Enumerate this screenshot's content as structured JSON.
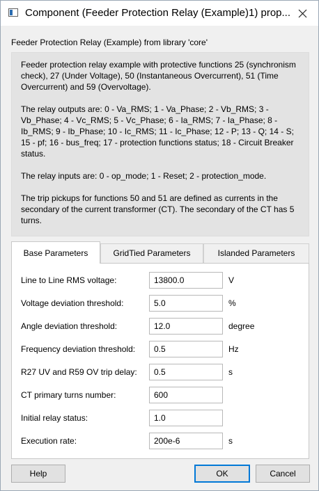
{
  "window": {
    "title": "Component (Feeder Protection Relay (Example)1) prop...",
    "close_glyph": "close-icon"
  },
  "heading": "Feeder Protection Relay (Example) from library 'core'",
  "description": [
    "Feeder protection relay example with protective functions 25 (synchronism check), 27 (Under Voltage), 50 (Instantaneous Overcurrent), 51 (Time Overcurrent) and 59 (Overvoltage).",
    "The relay outputs are: 0 - Va_RMS; 1 - Va_Phase; 2 - Vb_RMS; 3 - Vb_Phase; 4 - Vc_RMS; 5 - Vc_Phase; 6 - Ia_RMS; 7 - Ia_Phase; 8 - Ib_RMS; 9 - Ib_Phase; 10 - Ic_RMS; 11 - Ic_Phase; 12 - P; 13 - Q; 14 - S; 15 - pf; 16 - bus_freq; 17 - protection functions status; 18 - Circuit Breaker status.",
    "The relay inputs are: 0 - op_mode; 1 - Reset; 2 - protection_mode.",
    "The trip pickups for functions 50 and 51 are defined as currents in the secondary of the current transformer (CT). The secondary of the CT has 5 turns."
  ],
  "tabs": [
    "Base Parameters",
    "GridTied Parameters",
    "Islanded Parameters"
  ],
  "active_tab": "Base Parameters",
  "params": [
    {
      "label": "Line to Line RMS voltage:",
      "value": "13800.0",
      "unit": "V"
    },
    {
      "label": "Voltage deviation threshold:",
      "value": "5.0",
      "unit": "%"
    },
    {
      "label": "Angle deviation threshold:",
      "value": "12.0",
      "unit": "degree"
    },
    {
      "label": "Frequency deviation threshold:",
      "value": "0.5",
      "unit": "Hz"
    },
    {
      "label": "R27 UV and R59 OV trip delay:",
      "value": "0.5",
      "unit": "s"
    },
    {
      "label": "CT primary turns number:",
      "value": "600",
      "unit": ""
    },
    {
      "label": "Initial relay status:",
      "value": "1.0",
      "unit": ""
    },
    {
      "label": "Execution rate:",
      "value": "200e-6",
      "unit": "s"
    }
  ],
  "buttons": {
    "help": "Help",
    "ok": "OK",
    "cancel": "Cancel"
  },
  "colors": {
    "accent": "#0078d7",
    "description_bg": "#e3e3e3"
  }
}
